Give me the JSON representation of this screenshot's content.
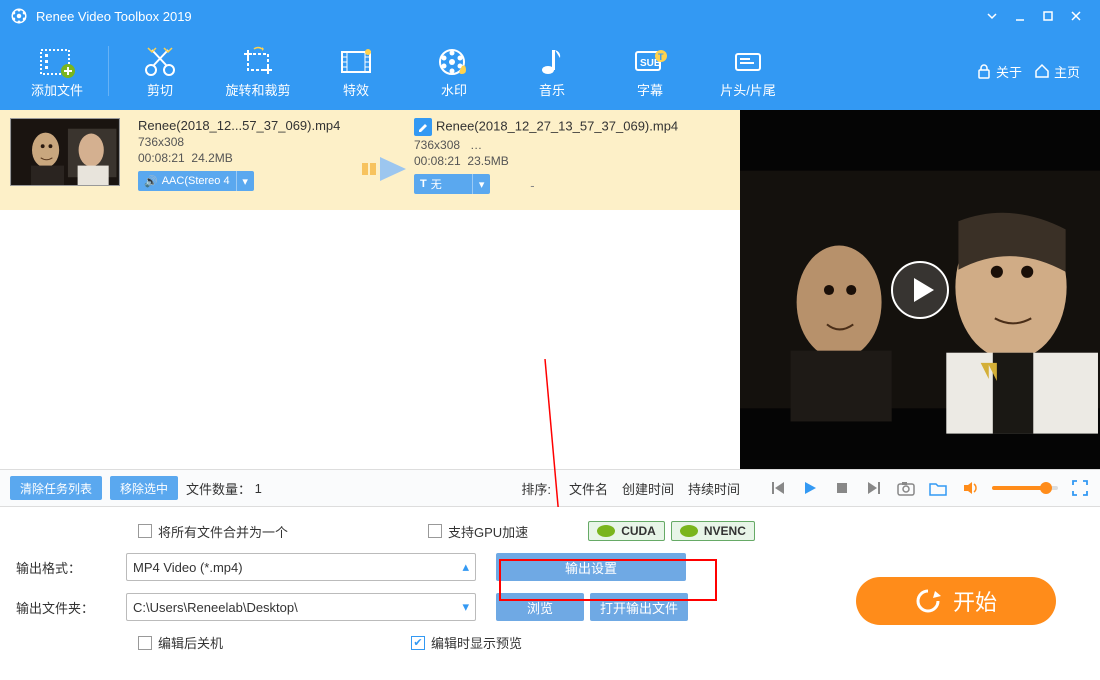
{
  "title": "Renee Video Toolbox 2019",
  "toolbar": {
    "add_file": "添加文件",
    "cut": "剪切",
    "rotate_crop": "旋转和裁剪",
    "effects": "特效",
    "watermark": "水印",
    "music": "音乐",
    "subtitle": "字幕",
    "intro_outro": "片头/片尾",
    "about": "关于",
    "home": "主页"
  },
  "task": {
    "src": {
      "name": "Renee(2018_12...57_37_069).mp4",
      "res": "736x308",
      "dur": "00:08:21",
      "size": "24.2MB",
      "audio_pill": "AAC(Stereo 4"
    },
    "dst": {
      "name": "Renee(2018_12_27_13_57_37_069).mp4",
      "res": "736x308",
      "ellipsis": "…",
      "dur": "00:08:21",
      "size": "23.5MB",
      "sub_pill": "无",
      "dash": "-"
    }
  },
  "taskbar": {
    "clear": "清除任务列表",
    "remove": "移除选中",
    "file_count_label": "文件数量：",
    "file_count": "1",
    "sort_label": "排序:",
    "sort_name": "文件名",
    "sort_created": "创建时间",
    "sort_duration": "持续时间"
  },
  "options": {
    "merge_all": "将所有文件合并为一个",
    "gpu_accel": "支持GPU加速",
    "cuda": "CUDA",
    "nvenc": "NVENC",
    "fmt_label": "输出格式：",
    "fmt_value": "MP4 Video (*.mp4)",
    "output_settings": "输出设置",
    "folder_label": "输出文件夹：",
    "folder_value": "C:\\Users\\Reneelab\\Desktop\\",
    "browse": "浏览",
    "open_folder": "打开输出文件",
    "shutdown_after": "编辑后关机",
    "preview_on_edit": "编辑时显示预览",
    "start": "开始"
  }
}
